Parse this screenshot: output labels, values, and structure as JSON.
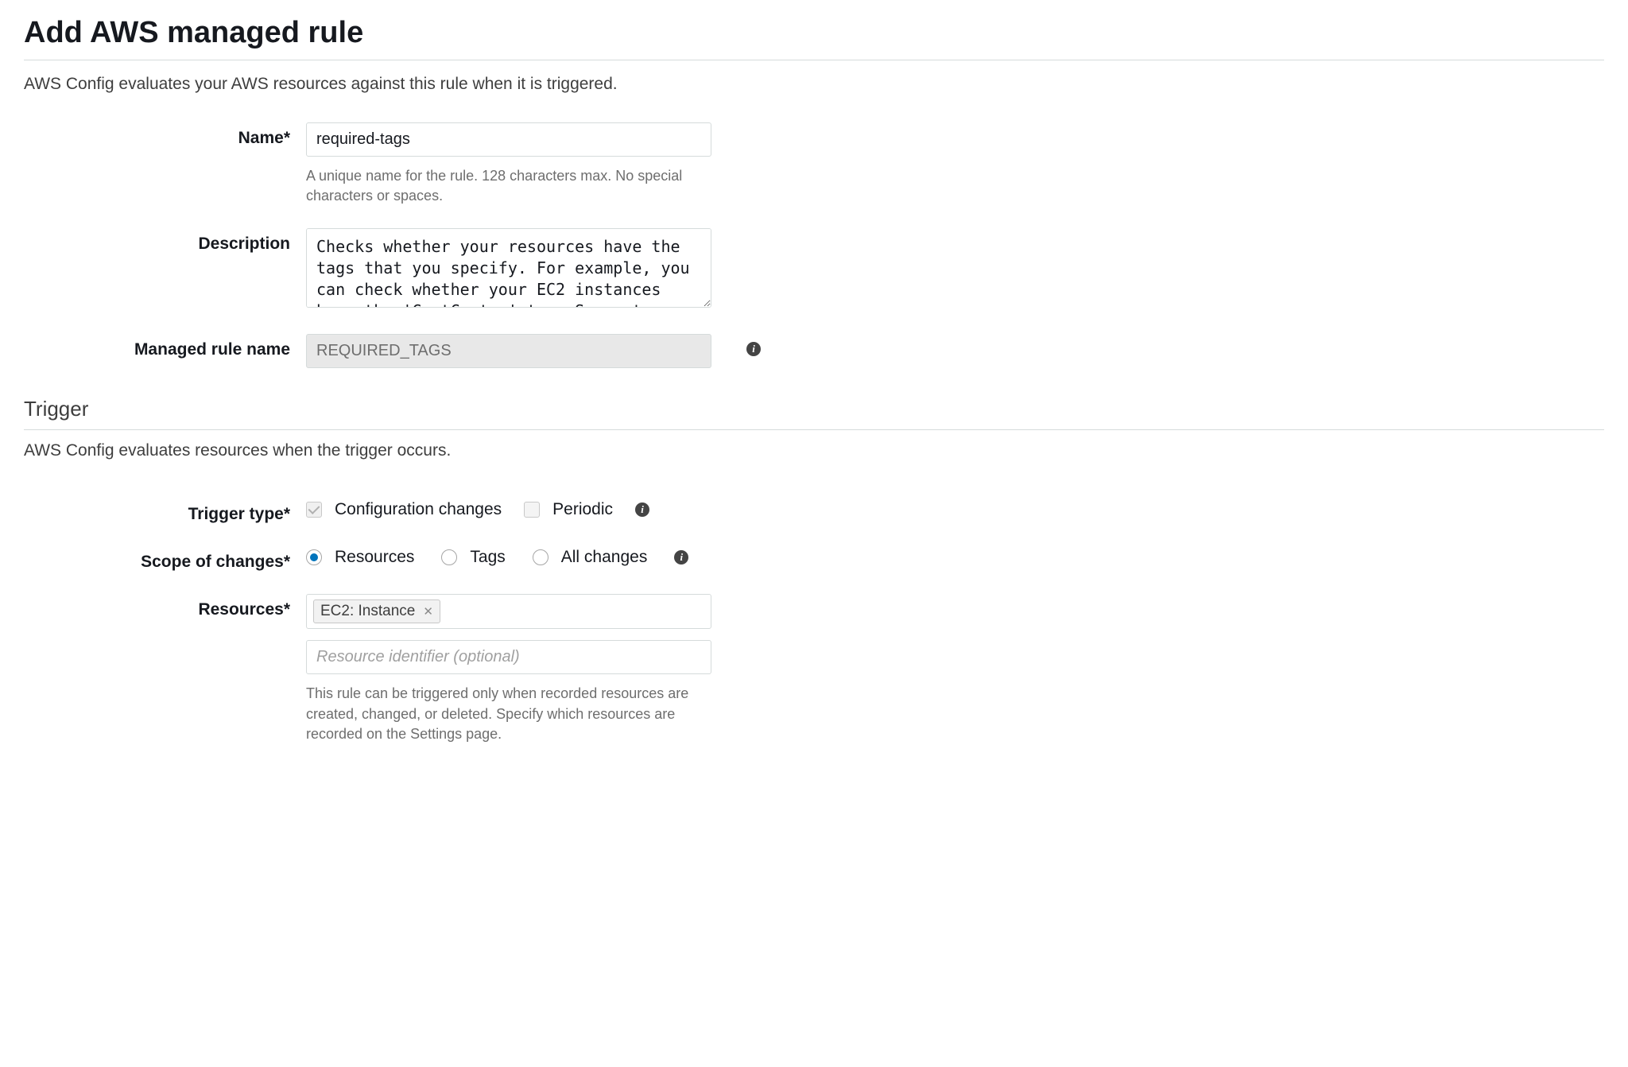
{
  "page": {
    "title": "Add AWS managed rule",
    "description": "AWS Config evaluates your AWS resources against this rule when it is triggered."
  },
  "form": {
    "name": {
      "label": "Name*",
      "value": "required-tags",
      "help": "A unique name for the rule. 128 characters max. No special characters or spaces."
    },
    "description": {
      "label": "Description",
      "value": "Checks whether your resources have the tags that you specify. For example, you can check whether your EC2 instances have the 'CostCenter' tag. Separate multiple values with commas."
    },
    "managed_rule_name": {
      "label": "Managed rule name",
      "value": "REQUIRED_TAGS"
    }
  },
  "trigger": {
    "section_title": "Trigger",
    "section_description": "AWS Config evaluates resources when the trigger occurs.",
    "trigger_type": {
      "label": "Trigger type*",
      "option_config_changes": "Configuration changes",
      "option_periodic": "Periodic"
    },
    "scope_of_changes": {
      "label": "Scope of changes*",
      "option_resources": "Resources",
      "option_tags": "Tags",
      "option_all_changes": "All changes"
    },
    "resources": {
      "label": "Resources*",
      "selected_tag": "EC2: Instance",
      "identifier_placeholder": "Resource identifier (optional)",
      "help": "This rule can be triggered only when recorded resources are created, changed, or deleted. Specify which resources are recorded on the Settings page."
    }
  }
}
